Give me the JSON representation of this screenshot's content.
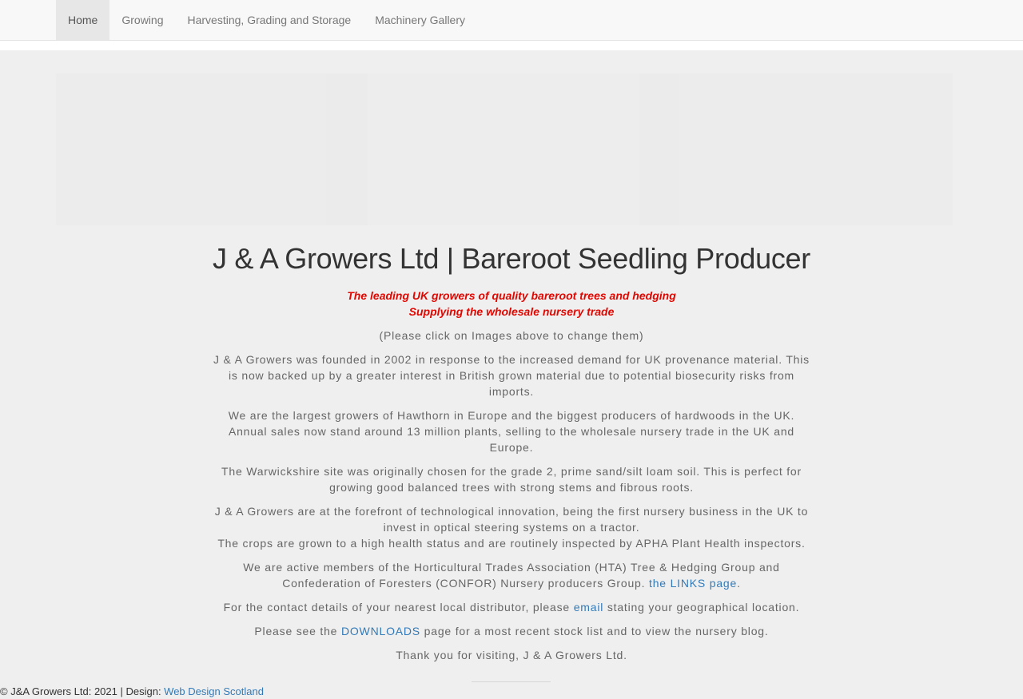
{
  "nav": {
    "items": [
      {
        "label": "Home"
      },
      {
        "label": "Growing"
      },
      {
        "label": "Harvesting, Grading and Storage"
      },
      {
        "label": "Machinery Gallery"
      }
    ]
  },
  "main": {
    "title": "J & A Growers Ltd | Bareroot Seedling Producer",
    "tagline": [
      "The leading UK growers of quality bareroot trees and hedging",
      "Supplying the wholesale nursery trade"
    ],
    "note": "(Please click on Images above to change them)",
    "p1": "J & A Growers was founded in 2002 in response to the increased demand for UK provenance material. This is now backed up by a greater interest in British grown material due to potential biosecurity risks from imports.",
    "p2": "We are the largest growers of Hawthorn in Europe and the biggest producers of hardwoods in the UK. Annual sales now stand around 13 million plants, selling to the wholesale nursery trade in the UK and Europe.",
    "p3": "The Warwickshire site was originally chosen for the grade 2, prime sand/silt loam soil. This is perfect for growing good balanced trees with strong stems and fibrous roots.",
    "p4": "J & A Growers are at the forefront of technological innovation, being the first nursery business in the UK to invest in optical steering systems on a tractor.",
    "p4b": "The crops are grown to a high health status and are routinely inspected by APHA Plant Health inspectors.",
    "p5_text": "We are active members of the Horticultural Trades Association (HTA) Tree & Hedging Group and Confederation of Foresters (CONFOR) Nursery producers Group.",
    "p5_link": "the LINKS page",
    "p5_end": ".",
    "p6_before": "For the contact details of your nearest local distributor, please",
    "p6_link": "email",
    "p6_after": "stating your geographical location.",
    "p7_before": "Please see the",
    "p7_link": "DOWNLOADS",
    "p7_after": "page for a most recent stock list and to view the nursery blog.",
    "p8": "Thank you for visiting, J & A Growers Ltd."
  },
  "footer": {
    "text": "© J&A Growers Ltd: 2021 | Design: ",
    "link": "Web Design Scotland"
  },
  "colors": {
    "tagline": "#e10600",
    "link": "#337ab7",
    "background": "#efefef"
  }
}
